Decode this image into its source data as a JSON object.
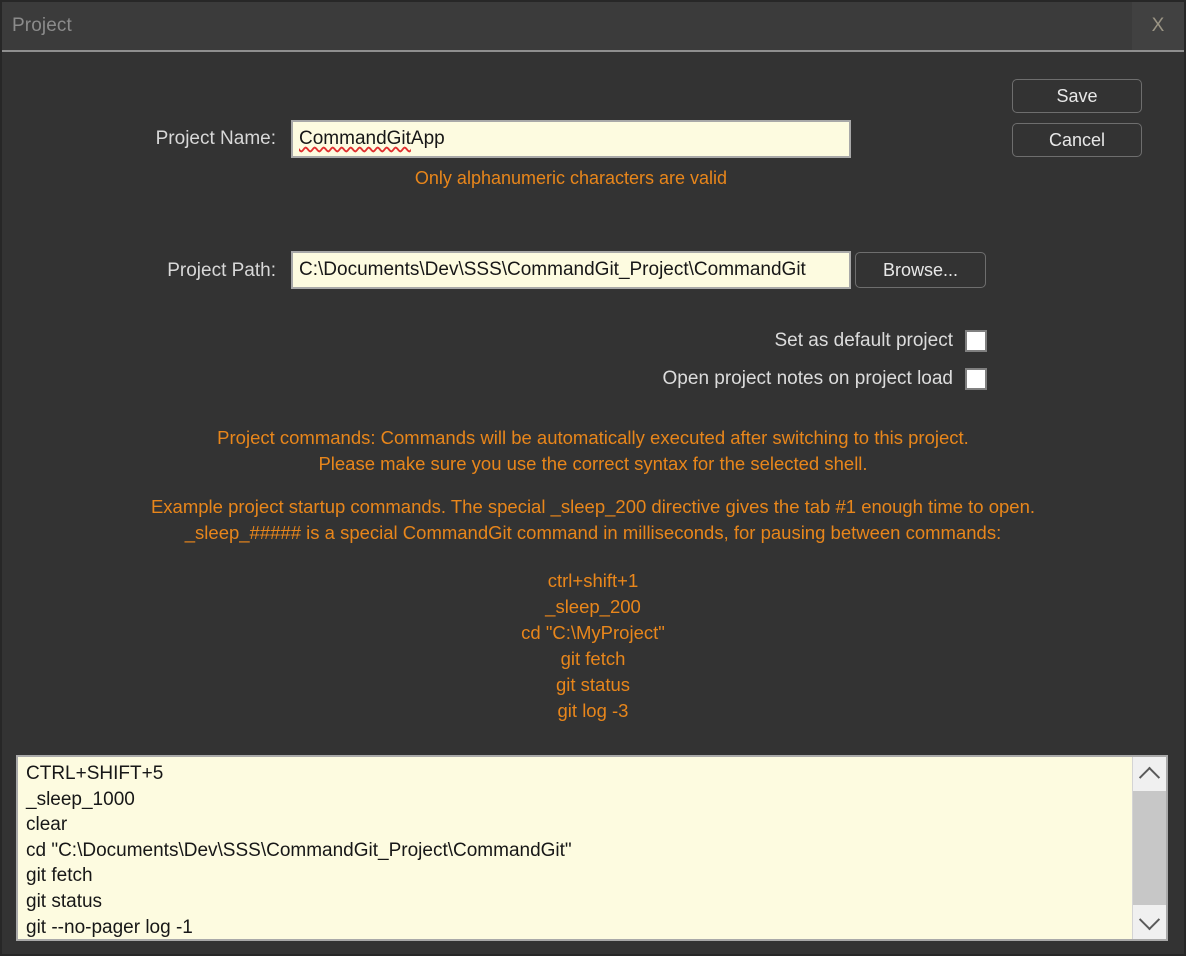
{
  "window": {
    "title": "Project",
    "close_label": "X"
  },
  "actions": {
    "save_label": "Save",
    "cancel_label": "Cancel",
    "browse_label": "Browse..."
  },
  "fields": {
    "project_name": {
      "label": "Project Name:",
      "value_misspelled": "CommandGit",
      "value_rest": " App",
      "hint": "Only alphanumeric characters are valid"
    },
    "project_path": {
      "label": "Project Path:",
      "value": "C:\\Documents\\Dev\\SSS\\CommandGit_Project\\CommandGit"
    }
  },
  "options": [
    {
      "label": "Set as default project",
      "checked": false
    },
    {
      "label": "Open project notes on project load",
      "checked": false
    }
  ],
  "info": {
    "commands_line1": "Project commands: Commands will be automatically executed after switching to this project.",
    "commands_line2": "Please make sure you use the correct syntax for the selected shell.",
    "example_line1": "Example project startup commands. The special _sleep_200 directive gives the tab #1 enough time to open.",
    "example_line2": "_sleep_##### is a special CommandGit command in milliseconds, for pausing between commands:",
    "example_commands": [
      "ctrl+shift+1",
      "_sleep_200",
      "cd \"C:\\MyProject\"",
      "git fetch",
      "git status",
      "git log -3"
    ]
  },
  "commands_editor": {
    "value": "CTRL+SHIFT+5\n_sleep_1000\nclear\ncd \"C:\\Documents\\Dev\\SSS\\CommandGit_Project\\CommandGit\"\ngit fetch\ngit status\ngit --no-pager log -1",
    "scroll_up_icon": "chevron-up-icon",
    "scroll_down_icon": "chevron-down-icon"
  },
  "colors": {
    "accent_orange": "#e8861b",
    "window_bg": "#333333",
    "titlebar_bg": "#3b3b3b",
    "input_bg": "#fdfbe0"
  }
}
